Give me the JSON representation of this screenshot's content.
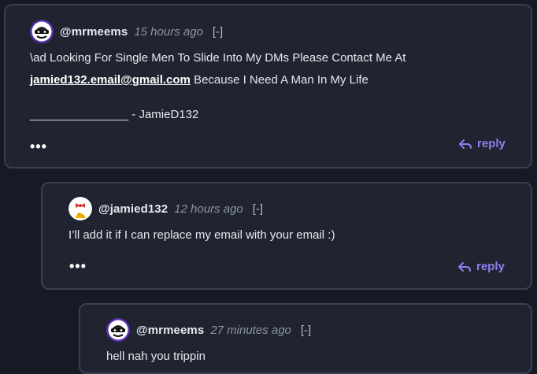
{
  "comments": [
    {
      "username": "@mrmeems",
      "time": "15 hours ago",
      "collapse": "[-]",
      "line1": "\\ad Looking For Single Men To Slide Into My DMs Please Contact Me At",
      "email": "jamied132.email@gmail.com",
      "line2_rest": " Because I Need A Man In My Life",
      "line3": "_______________ - JamieD132",
      "more": "•••",
      "reply": "reply"
    },
    {
      "username": "@jamied132",
      "time": "12 hours ago",
      "collapse": "[-]",
      "text": "I’ll add it if I can replace my email with your email :)",
      "more": "•••",
      "reply": "reply"
    },
    {
      "username": "@mrmeems",
      "time": "27 minutes ago",
      "collapse": "[-]",
      "text": "hell nah you trippin"
    }
  ],
  "colors": {
    "accent": "#8b80f0",
    "background": "#161a24",
    "card": "#1f2430",
    "border": "#3a4050"
  },
  "icons": {
    "avatar_mrmeems": "masked-face-avatar",
    "avatar_jamied132": "bow-character-avatar",
    "reply": "reply-arrow-icon",
    "more": "more-options-icon"
  }
}
